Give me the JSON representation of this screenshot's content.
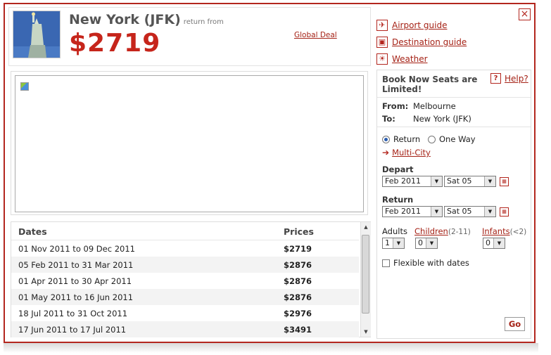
{
  "header": {
    "destination": "New York (JFK)",
    "return_from": "return from",
    "price": "$2719",
    "global_deal": "Global Deal"
  },
  "links": {
    "airport_guide": "Airport guide",
    "destination_guide": "Destination guide",
    "weather": "Weather"
  },
  "table": {
    "col_dates": "Dates",
    "col_prices": "Prices",
    "rows": [
      {
        "dates": "01 Nov 2011 to 09 Dec 2011",
        "price": "$2719"
      },
      {
        "dates": "05 Feb 2011 to 31 Mar 2011",
        "price": "$2876"
      },
      {
        "dates": "01 Apr 2011 to 30 Apr 2011",
        "price": "$2876"
      },
      {
        "dates": "01 May 2011 to 16 Jun 2011",
        "price": "$2876"
      },
      {
        "dates": "18 Jul 2011 to 31 Oct 2011",
        "price": "$2976"
      },
      {
        "dates": "17 Jun 2011 to 17 Jul 2011",
        "price": "$3491"
      }
    ]
  },
  "booking": {
    "title": "Book Now Seats are Limited!",
    "help": "Help?",
    "help_q": "?",
    "from_label": "From:",
    "from_value": "Melbourne",
    "to_label": "To:",
    "to_value": "New York (JFK)",
    "return_label": "Return",
    "oneway_label": "One Way",
    "multicity_label": "Multi-City",
    "depart_label": "Depart",
    "depart_month": "Feb 2011",
    "depart_day": "Sat 05",
    "return_heading": "Return",
    "return_month": "Feb 2011",
    "return_day": "Sat 05",
    "adults_label": "Adults",
    "children_label": "Children",
    "children_age": "(2-11)",
    "infants_label": "Infants",
    "infants_age": "(<2)",
    "adults_value": "1",
    "children_value": "0",
    "infants_value": "0",
    "flexible_label": "Flexible with dates",
    "go_label": "Go"
  },
  "colors": {
    "accent": "#b3261e",
    "price": "#c6251b",
    "link": "#a52216"
  }
}
